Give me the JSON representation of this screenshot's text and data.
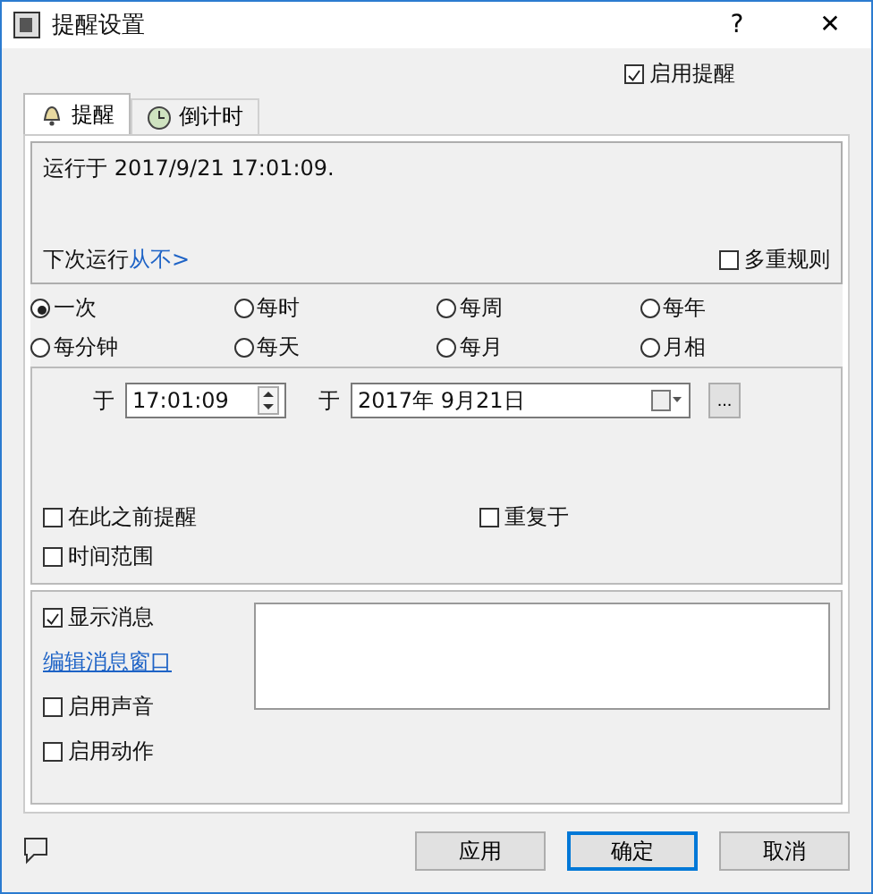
{
  "window": {
    "title": "提醒设置",
    "help": "?",
    "close": "✕"
  },
  "enable_reminder": {
    "label": "启用提醒",
    "checked": true
  },
  "tabs": [
    {
      "label": "提醒",
      "selected": true
    },
    {
      "label": "倒计时",
      "selected": false
    }
  ],
  "summary": {
    "run_at": "运行于 2017/9/21  17:01:09.",
    "next_run_label": "下次运行",
    "next_run_link": "从不>",
    "multi_rule": {
      "label": "多重规则",
      "checked": false
    }
  },
  "frequency": [
    {
      "label": "一次",
      "selected": true
    },
    {
      "label": "每时",
      "selected": false
    },
    {
      "label": "每周",
      "selected": false
    },
    {
      "label": "每年",
      "selected": false
    },
    {
      "label": "每分钟",
      "selected": false
    },
    {
      "label": "每天",
      "selected": false
    },
    {
      "label": "每月",
      "selected": false
    },
    {
      "label": "月相",
      "selected": false
    }
  ],
  "schedule": {
    "time_label": "于",
    "time": "17:01:09",
    "date_label": "于",
    "date": "2017年  9月21日",
    "more": "...",
    "options": [
      {
        "label": "在此之前提醒",
        "checked": false
      },
      {
        "label": "重复于",
        "checked": false
      },
      {
        "label": "时间范围",
        "checked": false
      }
    ]
  },
  "message": {
    "show": {
      "label": "显示消息",
      "checked": true
    },
    "edit_link": "编辑消息窗口",
    "sound": {
      "label": "启用声音",
      "checked": false
    },
    "action": {
      "label": "启用动作",
      "checked": false
    }
  },
  "buttons": [
    {
      "label": "应用",
      "default": false
    },
    {
      "label": "确定",
      "default": true
    },
    {
      "label": "取消",
      "default": false
    }
  ]
}
